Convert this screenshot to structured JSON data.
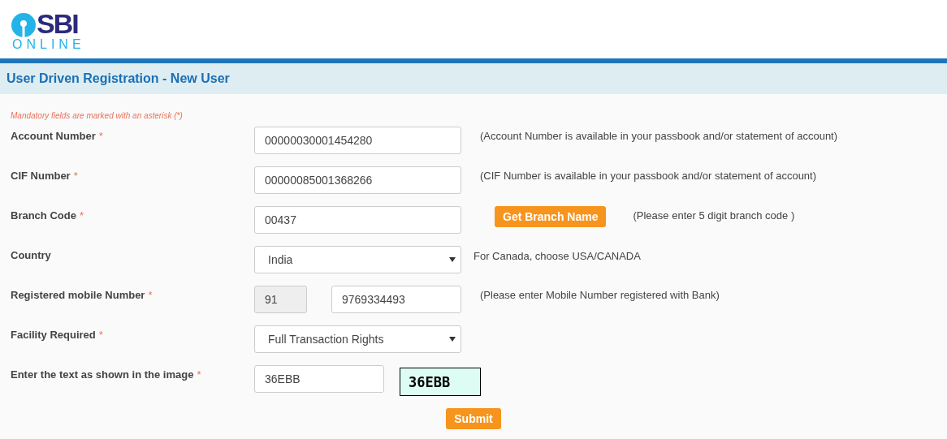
{
  "logo": {
    "brand": "SBI",
    "sub": "ONLINE"
  },
  "page_title": "User Driven Registration - New User",
  "mandatory_note": "Mandatory fields are marked with an asterisk (*)",
  "rows": [
    {
      "kind": "text",
      "label": "Account Number",
      "asterisk": "*",
      "value": "00000030001454280",
      "note": "(Account Number is available in your passbook and/or statement of account)"
    },
    {
      "kind": "text",
      "label": "CIF Number",
      "asterisk": "*",
      "value": "00000085001368266",
      "note": "(CIF Number is available in your passbook and/or statement of account)"
    },
    {
      "kind": "text",
      "label": "Branch Code",
      "asterisk": "*",
      "value": "00437",
      "button": "Get Branch Name",
      "note": "(Please enter 5 digit branch code )"
    },
    {
      "kind": "select",
      "label": "Country",
      "value": "India",
      "note": "For Canada, choose USA/CANADA"
    },
    {
      "kind": "phone",
      "label": "Registered mobile Number",
      "asterisk": "*",
      "code": "91",
      "value": "9769334493",
      "note": "(Please enter Mobile Number registered with Bank)"
    },
    {
      "kind": "select",
      "label": "Facility Required",
      "asterisk": "*",
      "value": "Full Transaction Rights"
    },
    {
      "kind": "captcha",
      "label": "Enter the text as shown in the image",
      "asterisk": "*",
      "value": "36EBB",
      "captcha_text": "36EBB"
    }
  ],
  "submit": "Submit"
}
